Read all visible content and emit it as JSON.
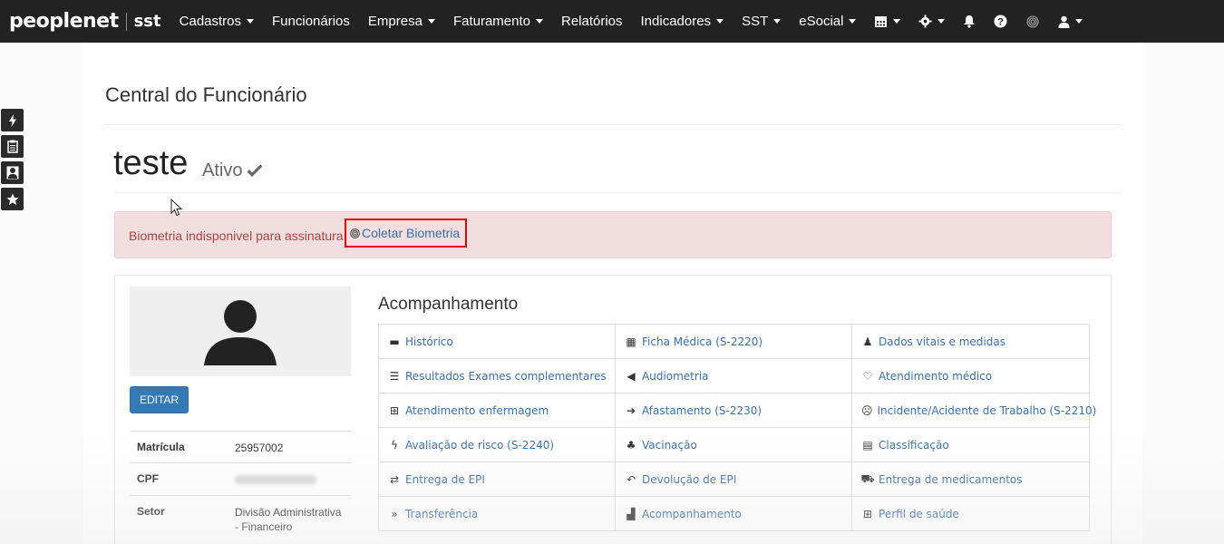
{
  "navbar": {
    "brand": "peoplenet",
    "brand_sub": "sst",
    "items": [
      {
        "label": "Cadastros",
        "dropdown": true
      },
      {
        "label": "Funcionários",
        "dropdown": false
      },
      {
        "label": "Empresa",
        "dropdown": true
      },
      {
        "label": "Faturamento",
        "dropdown": true
      },
      {
        "label": "Relatórios",
        "dropdown": false
      },
      {
        "label": "Indicadores",
        "dropdown": true
      },
      {
        "label": "SST",
        "dropdown": true
      },
      {
        "label": "eSocial",
        "dropdown": true
      }
    ],
    "icons": [
      "calendar-icon",
      "gear-icon",
      "bell-icon",
      "help-icon",
      "fingerprint-icon",
      "user-icon"
    ]
  },
  "side_tools": [
    "bolt-icon",
    "clipboard-icon",
    "user-icon",
    "star-icon"
  ],
  "page": {
    "title": "Central do Funcionário",
    "employee_name": "teste",
    "employee_status": "Ativo"
  },
  "alert": {
    "text": "Biometria indisponivel para assinatura",
    "link_label": "Coletar Biometria"
  },
  "profile": {
    "edit_label": "EDITAR",
    "fields": [
      {
        "key": "Matrícula",
        "value": "25957002"
      },
      {
        "key": "CPF",
        "value": ""
      },
      {
        "key": "Setor",
        "value": "Divisão Administrativa - Financeiro"
      }
    ]
  },
  "acompanhamento": {
    "title": "Acompanhamento",
    "items": [
      {
        "label": "Histórico",
        "icon": "archive-icon",
        "glyph": "▬"
      },
      {
        "label": "Ficha Médica (S-2220)",
        "icon": "briefcase-icon",
        "glyph": "▦"
      },
      {
        "label": "Dados vitais e medidas",
        "icon": "person-icon",
        "glyph": "♟"
      },
      {
        "label": "Resultados Exames complementares",
        "icon": "list-icon",
        "glyph": "☰"
      },
      {
        "label": "Audiometria",
        "icon": "bullhorn-icon",
        "glyph": "◀"
      },
      {
        "label": "Atendimento médico",
        "icon": "stethoscope-icon",
        "glyph": "♡"
      },
      {
        "label": "Atendimento enfermagem",
        "icon": "medkit-icon",
        "glyph": "⊞"
      },
      {
        "label": "Afastamento (S-2230)",
        "icon": "sign-out-icon",
        "glyph": "➔"
      },
      {
        "label": "Incidente/Acidente de Trabalho (S-2210)",
        "icon": "frown-icon",
        "glyph": "☹"
      },
      {
        "label": "Avaliação de risco (S-2240)",
        "icon": "bolt-icon",
        "glyph": "ϟ"
      },
      {
        "label": "Vacinação",
        "icon": "users-icon",
        "glyph": "♣"
      },
      {
        "label": "Classificação",
        "icon": "list-alt-icon",
        "glyph": "▤"
      },
      {
        "label": "Entrega de EPI",
        "icon": "exchange-icon",
        "glyph": "⇄"
      },
      {
        "label": "Devolução de EPI",
        "icon": "reply-icon",
        "glyph": "↶"
      },
      {
        "label": "Entrega de medicamentos",
        "icon": "ambulance-icon",
        "glyph": "⛟"
      },
      {
        "label": "Transferência",
        "icon": "angle-double-right-icon",
        "glyph": "»"
      },
      {
        "label": "Acompanhamento",
        "icon": "bar-chart-icon",
        "glyph": "▟"
      },
      {
        "label": "Perfil de saúde",
        "icon": "plus-square-icon",
        "glyph": "⊞"
      }
    ]
  }
}
